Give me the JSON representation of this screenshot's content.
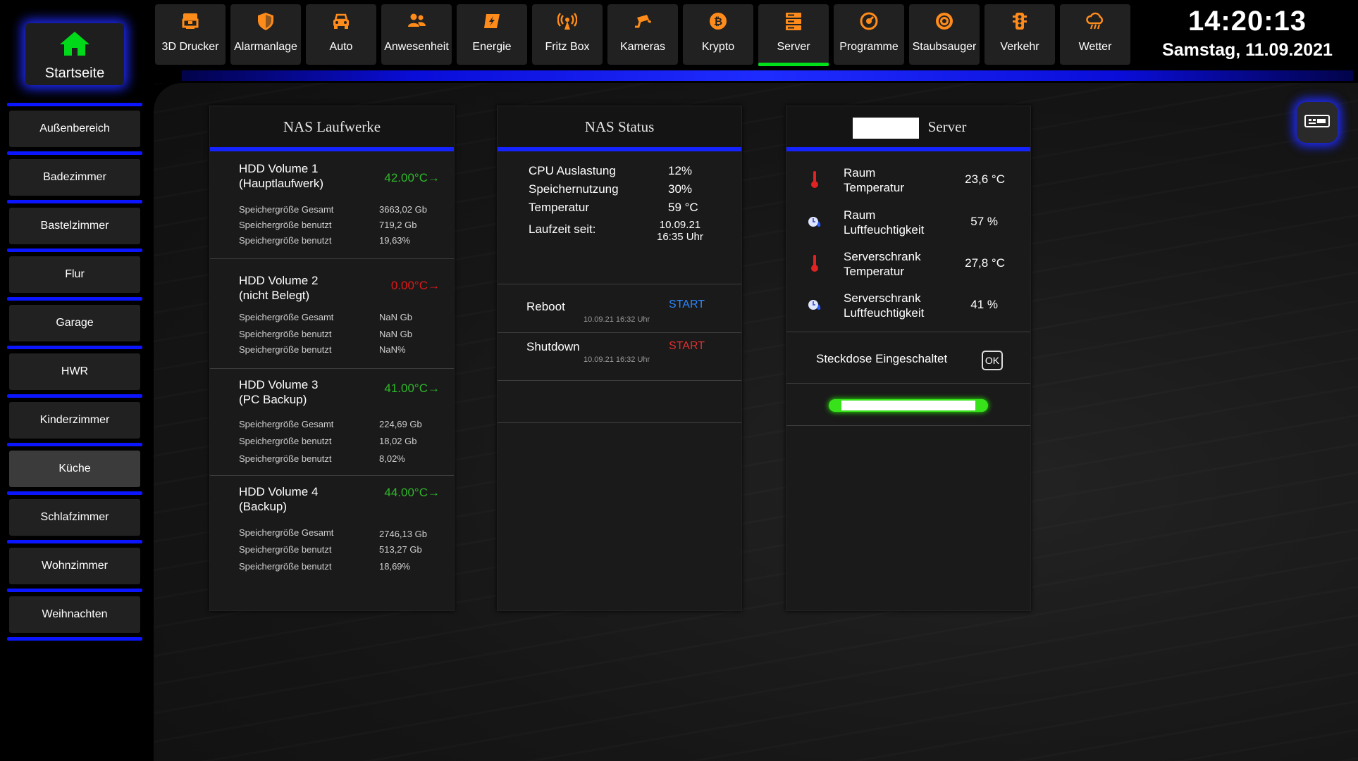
{
  "home": {
    "label": "Startseite"
  },
  "sidebar": {
    "items": [
      {
        "label": "Außenbereich"
      },
      {
        "label": "Badezimmer"
      },
      {
        "label": "Bastelzimmer"
      },
      {
        "label": "Flur"
      },
      {
        "label": "Garage"
      },
      {
        "label": "HWR"
      },
      {
        "label": "Kinderzimmer"
      },
      {
        "label": "Küche"
      },
      {
        "label": "Schlafzimmer"
      },
      {
        "label": "Wohnzimmer"
      },
      {
        "label": "Weihnachten"
      }
    ]
  },
  "topbar": {
    "icon_color": "#ff8c1a",
    "active_color": "#00e01a",
    "tabs": [
      {
        "label": "3D Drucker",
        "icon": "printer-3d-icon"
      },
      {
        "label": "Alarmanlage",
        "icon": "shield-icon"
      },
      {
        "label": "Auto",
        "icon": "car-icon"
      },
      {
        "label": "Anwesenheit",
        "icon": "people-icon"
      },
      {
        "label": "Energie",
        "icon": "lightning-icon"
      },
      {
        "label": "Fritz Box",
        "icon": "router-icon"
      },
      {
        "label": "Kameras",
        "icon": "camera-icon"
      },
      {
        "label": "Krypto",
        "icon": "bitcoin-icon"
      },
      {
        "label": "Server",
        "icon": "server-icon",
        "active": true
      },
      {
        "label": "Programme",
        "icon": "program-icon"
      },
      {
        "label": "Staubsauger",
        "icon": "vacuum-icon"
      },
      {
        "label": "Verkehr",
        "icon": "traffic-light-icon"
      },
      {
        "label": "Wetter",
        "icon": "weather-icon"
      }
    ]
  },
  "clock": {
    "time": "14:20:13",
    "date": "Samstag, 11.09.2021"
  },
  "nas_drives": {
    "title": "NAS Laufwerke",
    "drives": [
      {
        "name1": "HDD Volume 1",
        "name2": "(Hauptlaufwerk)",
        "temp": "42.00°C→",
        "status": "green",
        "labels": [
          "Speichergröße Gesamt",
          "Speichergröße benutzt",
          "Speichergröße benutzt"
        ],
        "values": [
          "3663,02 Gb",
          "719,2 Gb",
          "19,63%"
        ]
      },
      {
        "name1": "HDD Volume 2",
        "name2": "(nicht Belegt)",
        "temp": "0.00°C→",
        "status": "red",
        "labels": [
          "Speichergröße Gesamt",
          "Speichergröße benutzt",
          "Speichergröße benutzt"
        ],
        "values": [
          "NaN Gb",
          "NaN Gb",
          "NaN%"
        ]
      },
      {
        "name1": "HDD Volume 3",
        "name2": "(PC Backup)",
        "temp": "41.00°C→",
        "status": "green",
        "labels": [
          "Speichergröße Gesamt",
          "Speichergröße benutzt",
          "Speichergröße benutzt"
        ],
        "values": [
          "224,69 Gb",
          "18,02 Gb",
          "8,02%"
        ]
      },
      {
        "name1": "HDD Volume 4",
        "name2": "(Backup)",
        "temp": "44.00°C→",
        "status": "green",
        "labels": [
          "Speichergröße Gesamt",
          "Speichergröße benutzt",
          "Speichergröße benutzt"
        ],
        "values": [
          "2746,13 Gb",
          "513,27 Gb",
          "18,69%"
        ]
      }
    ]
  },
  "nas_status": {
    "title": "NAS Status",
    "cpu_label": "CPU Auslastung",
    "cpu_value": "12%",
    "mem_label": "Speichernutzung",
    "mem_value": "30%",
    "temp_label": "Temperatur",
    "temp_value": "59 °C",
    "uptime_label": "Laufzeit seit:",
    "uptime_date": "10.09.21",
    "uptime_time": "16:35 Uhr",
    "reboot": {
      "label": "Reboot",
      "button": "START",
      "last": "10.09.21 16:32 Uhr"
    },
    "shutdown": {
      "label": "Shutdown",
      "button": "START",
      "last": "10.09.21 16:32 Uhr"
    }
  },
  "server": {
    "title": "Server",
    "rows": [
      {
        "label1": "Raum",
        "label2": "Temperatur",
        "value": "23,6 °C",
        "icon": "thermometer-icon"
      },
      {
        "label1": "Raum",
        "label2": "Luftfeuchtigkeit",
        "value": "57 %",
        "icon": "humidity-icon"
      },
      {
        "label1": "Serverschrank",
        "label2": "Temperatur",
        "value": "27,8 °C",
        "icon": "thermometer-icon"
      },
      {
        "label1": "Serverschrank",
        "label2": "Luftfeuchtigkeit",
        "value": "41 %",
        "icon": "humidity-icon"
      }
    ],
    "plug_label": "Steckdose Eingeschaltet",
    "ok_label": "OK"
  }
}
